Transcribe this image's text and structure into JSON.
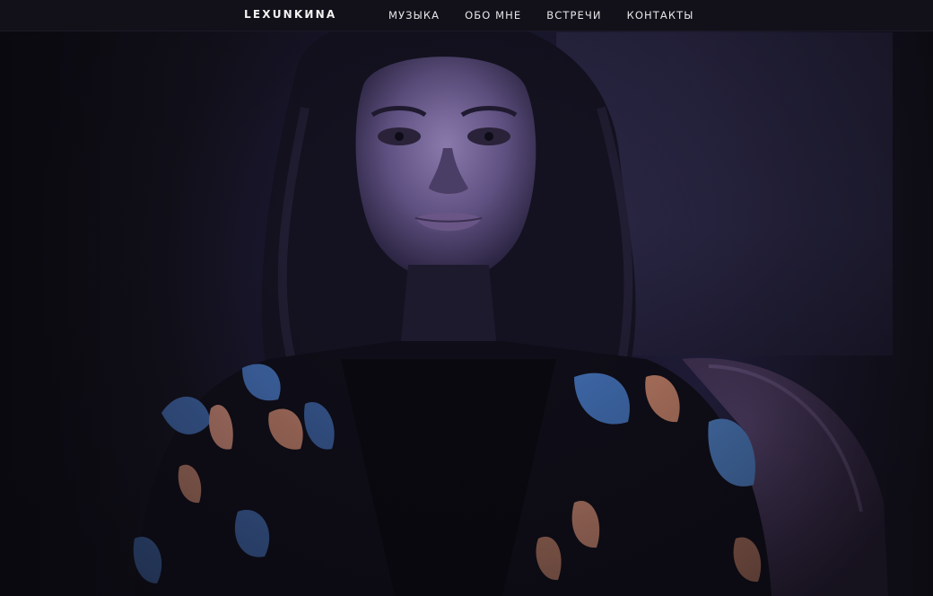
{
  "header": {
    "logo": "LEXUNKИNA",
    "nav": [
      {
        "label": "МУЗЫКА"
      },
      {
        "label": "ОБО МНЕ"
      },
      {
        "label": "ВСТРЕЧИ"
      },
      {
        "label": "КОНТАКТЫ"
      }
    ]
  },
  "colors": {
    "header_bg": "#121119",
    "nav_text": "#e6e6ea",
    "hero_tint": "#2a2448"
  },
  "hero": {
    "image": "portrait-photo"
  }
}
